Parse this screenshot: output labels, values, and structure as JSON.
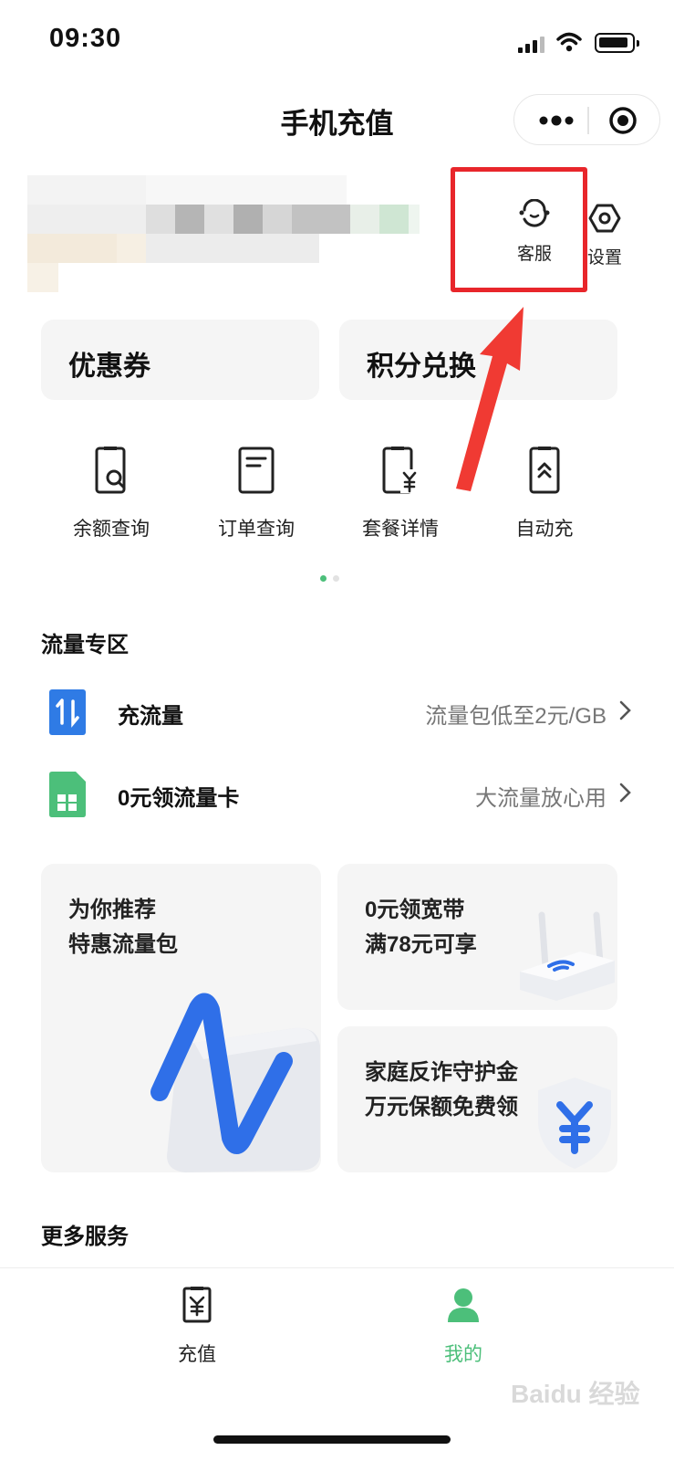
{
  "status_bar": {
    "time": "09:30"
  },
  "nav": {
    "title": "手机充值"
  },
  "header_actions": {
    "service_label": "客服",
    "settings_label": "设置"
  },
  "cards": {
    "coupon": "优惠券",
    "points": "积分兑换"
  },
  "quick_actions": [
    "余额查询",
    "订单查询",
    "套餐详情",
    "自动充"
  ],
  "traffic_zone": {
    "title": "流量专区",
    "rows": [
      {
        "label": "充流量",
        "desc": "流量包低至2元/GB"
      },
      {
        "label": "0元领流量卡",
        "desc": "大流量放心用"
      }
    ]
  },
  "promos": {
    "recommend": {
      "line1": "为你推荐",
      "line2": "特惠流量包"
    },
    "broadband": {
      "line1": "0元领宽带",
      "line2": "满78元可享"
    },
    "anti_fraud": {
      "line1": "家庭反诈守护金",
      "line2": "万元保额免费领"
    }
  },
  "more_services": {
    "title": "更多服务"
  },
  "tab_bar": {
    "recharge": "充值",
    "mine": "我的"
  },
  "watermark": "Baidu 经验",
  "colors": {
    "accent_green": "#4cbf7a",
    "highlight_red": "#e8262b",
    "blue": "#2f7be5"
  }
}
